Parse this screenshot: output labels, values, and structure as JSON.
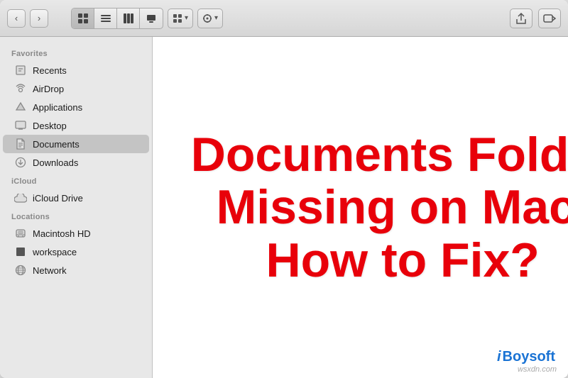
{
  "toolbar": {
    "back_label": "‹",
    "forward_label": "›",
    "view_grid_label": "⊞",
    "view_list_label": "≡",
    "view_col_label": "⋮⋮",
    "view_cover_label": "⊟",
    "arrange_label": "⊞",
    "arrange_arrow": "▾",
    "action_label": "⚙",
    "action_arrow": "▾",
    "share_label": "⬆",
    "tag_label": "⬡"
  },
  "sidebar": {
    "favorites_label": "Favorites",
    "icloud_label": "iCloud",
    "locations_label": "Locations",
    "items": [
      {
        "id": "recents",
        "icon": "🕐",
        "label": "Recents",
        "active": false
      },
      {
        "id": "airdrop",
        "icon": "📡",
        "label": "AirDrop",
        "active": false
      },
      {
        "id": "applications",
        "icon": "🚀",
        "label": "Applications",
        "active": false
      },
      {
        "id": "desktop",
        "icon": "🖥",
        "label": "Desktop",
        "active": false
      },
      {
        "id": "documents",
        "icon": "📄",
        "label": "Documents",
        "active": true
      },
      {
        "id": "downloads",
        "icon": "⬇",
        "label": "Downloads",
        "active": false
      }
    ],
    "icloud_items": [
      {
        "id": "icloud-drive",
        "icon": "☁",
        "label": "iCloud Drive",
        "active": false
      }
    ],
    "location_items": [
      {
        "id": "macintosh-hd",
        "icon": "💾",
        "label": "Macintosh HD",
        "active": false
      },
      {
        "id": "workspace",
        "icon": "⬛",
        "label": "workspace",
        "active": false
      },
      {
        "id": "network",
        "icon": "🌐",
        "label": "Network",
        "active": false
      }
    ]
  },
  "overlay": {
    "line1": "Documents Folder",
    "line2": "Missing on Mac,",
    "line3": "How to Fix?"
  },
  "brand": {
    "prefix": "i",
    "name": "Boysoft"
  },
  "watermark": {
    "text": "wsxdn.com"
  }
}
